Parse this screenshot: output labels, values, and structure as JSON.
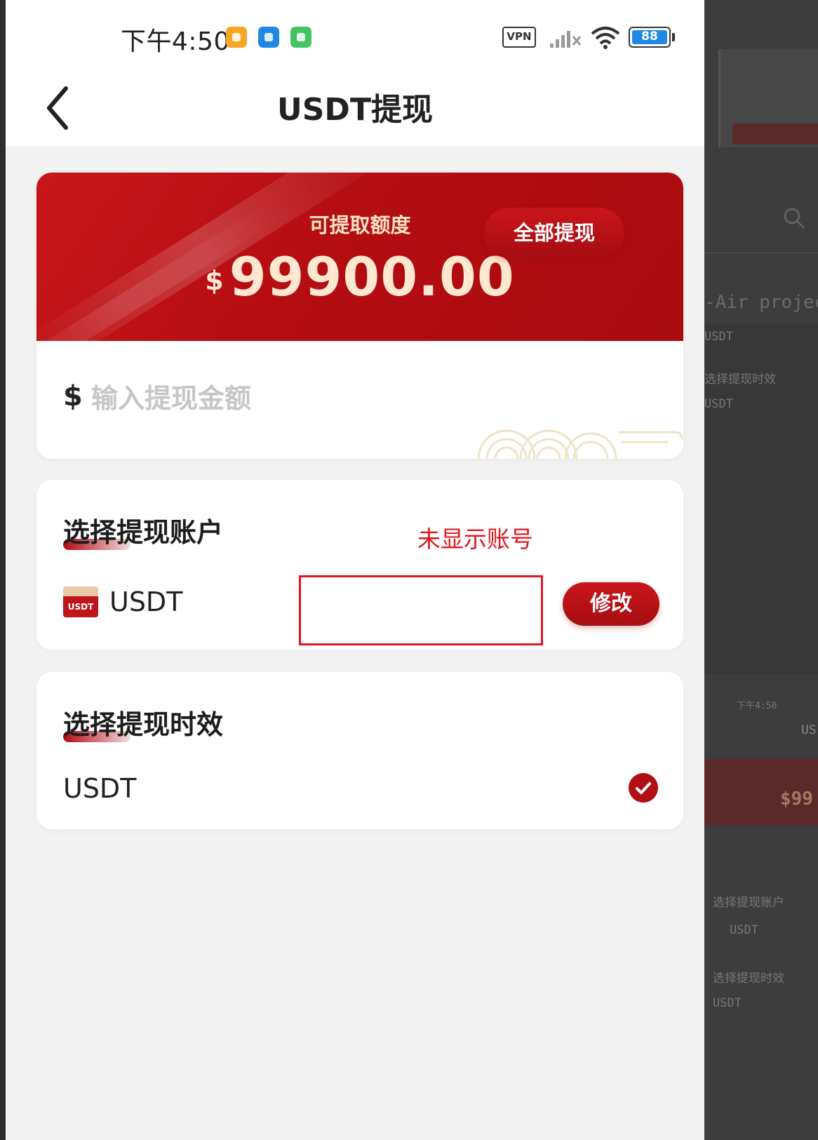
{
  "status_bar": {
    "time": "下午4:50",
    "vpn": "VPN",
    "battery": "88"
  },
  "nav": {
    "title": "USDT提现"
  },
  "balance": {
    "label": "可提取额度",
    "currency": "$",
    "amount": "99900.00"
  },
  "amount_input": {
    "currency": "$",
    "placeholder": "输入提现金额",
    "withdraw_all_label": "全部提现"
  },
  "account_section": {
    "title": "选择提现账户",
    "badge_text": "USDT",
    "account_name": "USDT",
    "modify_label": "修改",
    "annotation": "未显示账号"
  },
  "speed_section": {
    "title": "选择提现时效",
    "option_name": "USDT",
    "selected": true
  },
  "colors": {
    "brand_red": "#b20f14",
    "balance_text": "#ffe8cf",
    "annotation_red": "#e3141b"
  },
  "background_app": {
    "code_text": "-Air projec",
    "mini_time": "下午4:50",
    "mini_title": "US",
    "mini_amount": "$99",
    "mini_account_title": "选择提现账户",
    "mini_account_name": "USDT",
    "mini_speed_title": "选择提现时效",
    "mini_speed_name": "USDT",
    "mini_section_a": "USDT",
    "mini_section_b": "选择提现时效",
    "mini_section_c": "USDT"
  }
}
